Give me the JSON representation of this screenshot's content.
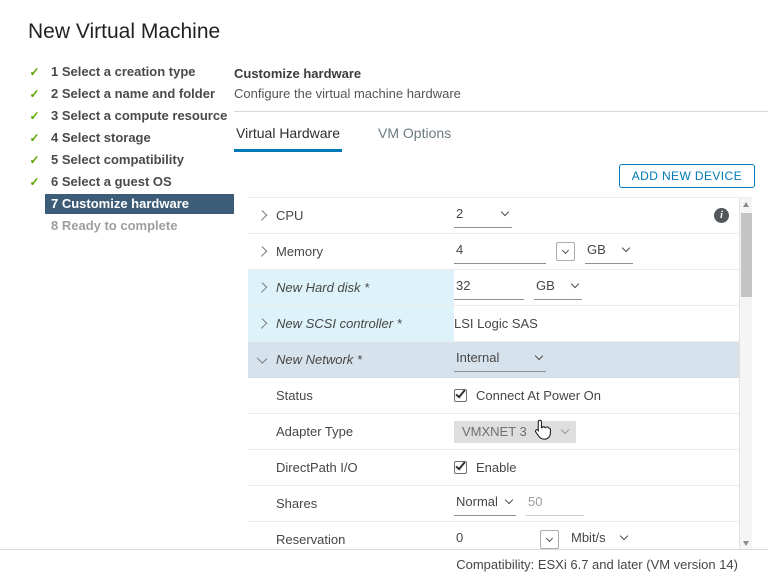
{
  "icons": {
    "check": "✓",
    "info": "i"
  },
  "title": "New Virtual Machine",
  "steps": [
    {
      "label": "1 Select a creation type",
      "state": "done"
    },
    {
      "label": "2 Select a name and folder",
      "state": "done"
    },
    {
      "label": "3 Select a compute resource",
      "state": "done"
    },
    {
      "label": "4 Select storage",
      "state": "done"
    },
    {
      "label": "5 Select compatibility",
      "state": "done"
    },
    {
      "label": "6 Select a guest OS",
      "state": "done"
    },
    {
      "label": "7 Customize hardware",
      "state": "active"
    },
    {
      "label": "8 Ready to complete",
      "state": "pending"
    }
  ],
  "main": {
    "heading": "Customize hardware",
    "subheading": "Configure the virtual machine hardware",
    "tabs": [
      {
        "label": "Virtual Hardware",
        "active": true
      },
      {
        "label": "VM Options",
        "active": false
      }
    ],
    "add_device_button": "ADD NEW DEVICE"
  },
  "hardware": {
    "cpu": {
      "label": "CPU",
      "value": "2"
    },
    "memory": {
      "label": "Memory",
      "value": "4",
      "unit": "GB"
    },
    "hard_disk": {
      "label": "New Hard disk *",
      "value": "32",
      "unit": "GB"
    },
    "scsi_controller": {
      "label": "New SCSI controller *",
      "value": "LSI Logic SAS"
    },
    "network": {
      "label": "New Network *",
      "value": "Internal"
    },
    "status": {
      "label": "Status",
      "option": "Connect At Power On",
      "checked": true
    },
    "adapter_type": {
      "label": "Adapter Type",
      "value": "VMXNET 3"
    },
    "directpath_io": {
      "label": "DirectPath I/O",
      "option": "Enable",
      "checked": true
    },
    "shares": {
      "label": "Shares",
      "value": "Normal",
      "secondary_value": "50"
    },
    "reservation": {
      "label": "Reservation",
      "value": "0",
      "unit": "Mbit/s"
    }
  },
  "footer": {
    "compatibility": "Compatibility: ESXi 6.7 and later (VM version 14)"
  },
  "colors": {
    "accent_blue": "#0079B8",
    "step_active_bg": "#3D5C77",
    "check_green": "#5AA700",
    "new_device_row_bg": "#DEF3F9",
    "selected_row_bg": "#D7E3EC"
  }
}
